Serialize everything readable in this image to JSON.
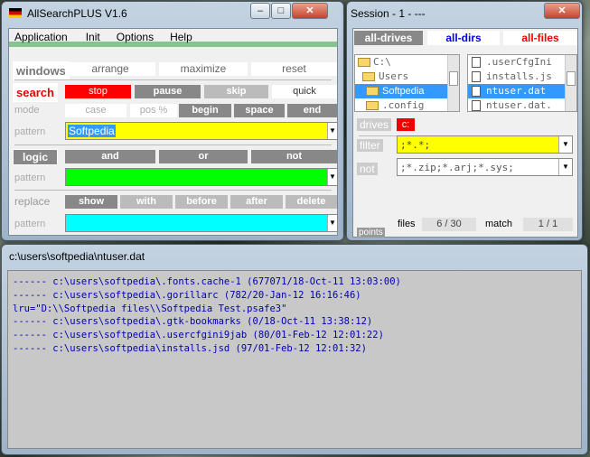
{
  "main_window": {
    "title": "AllSearchPLUS   V1.6",
    "menu": [
      "Application",
      "Init",
      "Options",
      "Help"
    ],
    "windows": {
      "label": "windows",
      "arrange": "arrange",
      "maximize": "maximize",
      "reset": "reset"
    },
    "search": {
      "label": "search",
      "stop": "stop",
      "pause": "pause",
      "skip": "skip",
      "quick": "quick"
    },
    "mode": {
      "label": "mode",
      "case": "case",
      "pos": "pos %",
      "begin": "begin",
      "space": "space",
      "end": "end"
    },
    "pattern1": {
      "label": "pattern",
      "value": "Softpedia"
    },
    "logic": {
      "label": "logic",
      "and": "and",
      "or": "or",
      "not": "not"
    },
    "pattern2": {
      "label": "pattern",
      "value": ""
    },
    "replace": {
      "label": "replace",
      "show": "show",
      "with": "with",
      "before": "before",
      "after": "after",
      "delete": "delete"
    },
    "pattern3": {
      "label": "pattern",
      "value": ""
    }
  },
  "session_window": {
    "title": "Session - 1 - ---",
    "tabs": [
      "all-drives",
      "all-dirs",
      "all-files"
    ],
    "dirs": [
      "C:\\",
      "Users",
      "Softpedia",
      ".config"
    ],
    "files": [
      ".userCfgIni",
      "installs.js",
      "ntuser.dat",
      "ntuser.dat."
    ],
    "drives_label": "drives",
    "drive_value": "c:",
    "filter_label": "filter",
    "filter_value": ";*.*;",
    "not_label": "not",
    "not_value": ";*.zip;*.arj;*.sys;",
    "files_label": "files",
    "files_count": "6 / 30",
    "match_label": "match",
    "match_count": "1 / 1",
    "points_label": "points"
  },
  "output_window": {
    "title": "c:\\users\\softpedia\\ntuser.dat",
    "lines": [
      "------ c:\\users\\softpedia\\.fonts.cache-1 (677071/18-Oct-11 13:03:00)",
      "------ c:\\users\\softpedia\\.gorillarc (782/20-Jan-12 16:16:46)",
      "lru=\"D:\\\\Softpedia files\\\\Softpedia Test.psafe3\"",
      "------ c:\\users\\softpedia\\.gtk-bookmarks (0/18-Oct-11 13:38:12)",
      "------ c:\\users\\softpedia\\.usercfgini9jab (80/01-Feb-12 12:01:22)",
      "------ c:\\users\\softpedia\\installs.jsd (97/01-Feb-12 12:01:32)"
    ]
  },
  "colors": {
    "red": "#ff0000",
    "green": "#00ff00",
    "yellow": "#ffff00",
    "cyan": "#00ffff",
    "link_blue": "#0000ee"
  }
}
